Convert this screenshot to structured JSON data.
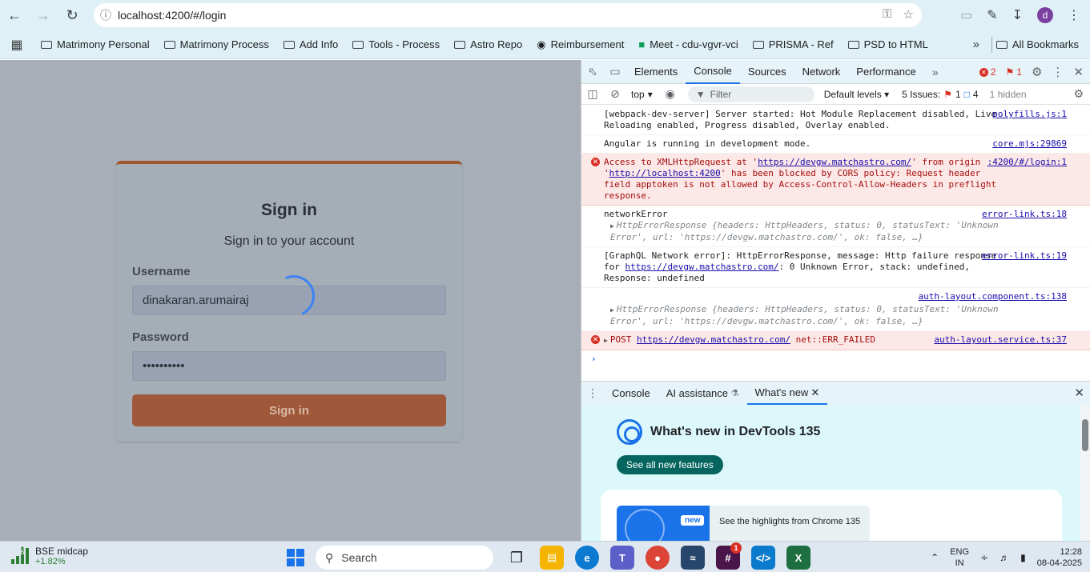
{
  "browser": {
    "url": "localhost:4200/#/login",
    "profile_initial": "d"
  },
  "bookmarks": {
    "items": [
      "Matrimony Personal",
      "Matrimony Process",
      "Add Info",
      "Tools - Process",
      "Astro Repo",
      "Reimbursement",
      "Meet - cdu-vgvr-vci",
      "PRISMA - Ref",
      "PSD to HTML"
    ],
    "all_label": "All Bookmarks"
  },
  "login": {
    "title": "Sign in",
    "subtitle": "Sign in to your account",
    "username_label": "Username",
    "username_value": "dinakaran.arumairaj",
    "password_label": "Password",
    "password_value": "••••••••••",
    "button_label": "Sign in"
  },
  "devtools": {
    "tabs": [
      "Elements",
      "Console",
      "Sources",
      "Network",
      "Performance"
    ],
    "active_tab": "Console",
    "error_count": "2",
    "warning_count": "1",
    "toolbar": {
      "context": "top",
      "filter_placeholder": "Filter",
      "levels": "Default levels",
      "issues_label": "5 Issues:",
      "issues_errors": "1",
      "issues_info": "4",
      "hidden": "1 hidden"
    },
    "messages": [
      {
        "text": "[webpack-dev-server] Server started: Hot Module Replacement disabled, Live Reloading enabled, Progress disabled, Overlay enabled.",
        "source": "polyfills.js:1"
      },
      {
        "text": "Angular is running in development mode.",
        "source": "core.mjs:29869"
      },
      {
        "pre": "Access to XMLHttpRequest at '",
        "link1": "https://devgw.matchastro.com/",
        "mid": "' from origin '",
        "link2": "http://localhost:4200",
        "post": "' has been blocked by CORS policy: Request header field apptoken is not allowed by Access-Control-Allow-Headers in preflight response.",
        "source": ":4200/#/login:1"
      },
      {
        "text": "networkError",
        "obj": "HttpErrorResponse {headers: HttpHeaders, status: 0, statusText: 'Unknown Error', url: 'https://devgw.matchastro.com/', ok: false, …}",
        "source": "error-link.ts:18"
      },
      {
        "pre": "[GraphQL Network error]: HttpErrorResponse, message: Http failure response for ",
        "link": "https://devgw.matchastro.com/",
        "post": ": 0 Unknown Error, stack: undefined, Response: undefined",
        "source": "error-link.ts:19"
      },
      {
        "obj": "HttpErrorResponse {headers: HttpHeaders, status: 0, statusText: 'Unknown Error', url: 'https://devgw.matchastro.com/', ok: false, …}",
        "source": "auth-layout.component.ts:138"
      },
      {
        "method": "POST",
        "link": "https://devgw.matchastro.com/",
        "post": "net::ERR_FAILED",
        "source": "auth-layout.service.ts:37"
      }
    ],
    "drawer_tabs": [
      "Console",
      "AI assistance",
      "What's new"
    ],
    "whats_new": {
      "title": "What's new in DevTools 135",
      "button": "See all new features",
      "badge": "new",
      "highlight": "See the highlights from Chrome 135"
    }
  },
  "taskbar": {
    "stock_name": "BSE midcap",
    "stock_change": "+1.82%",
    "stock_badge": "6",
    "search_placeholder": "Search",
    "lang_line1": "ENG",
    "lang_line2": "IN",
    "time": "12:28",
    "date": "08-04-2025",
    "app_badge": "1"
  }
}
